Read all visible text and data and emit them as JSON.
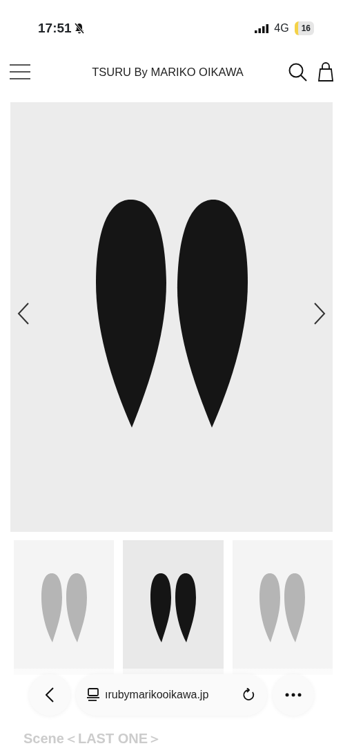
{
  "status_bar": {
    "time": "17:51",
    "network": "4G",
    "battery": "16"
  },
  "header": {
    "title": "TSURU By MARIKO OIKAWA"
  },
  "gallery": {
    "thumbnails": [
      {
        "selected": false
      },
      {
        "selected": true
      },
      {
        "selected": false
      }
    ]
  },
  "browser_bar": {
    "url": "ırubymarikooikawa.jp"
  },
  "section_title": "Scene＜LAST ONE＞"
}
